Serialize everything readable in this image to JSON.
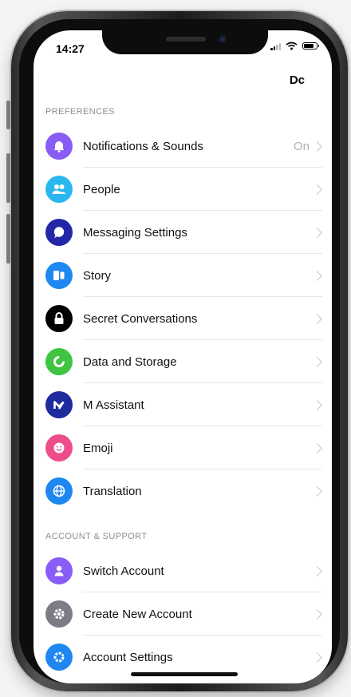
{
  "status_bar": {
    "time": "14:27"
  },
  "header": {
    "action_label": "Dc"
  },
  "sections": [
    {
      "title": "PREFERENCES",
      "items": [
        {
          "label": "Notifications & Sounds",
          "value": "On",
          "icon": "bell-icon",
          "color": "#8a5cf6"
        },
        {
          "label": "People",
          "value": "",
          "icon": "people-icon",
          "color": "#2ab7f0"
        },
        {
          "label": "Messaging Settings",
          "value": "",
          "icon": "chat-bubble-icon",
          "color": "#2426a8"
        },
        {
          "label": "Story",
          "value": "",
          "icon": "story-icon",
          "color": "#1e88f0"
        },
        {
          "label": "Secret Conversations",
          "value": "",
          "icon": "lock-icon",
          "color": "#000000"
        },
        {
          "label": "Data and Storage",
          "value": "",
          "icon": "data-circle-icon",
          "color": "#3ec43e"
        },
        {
          "label": "M Assistant",
          "value": "",
          "icon": "m-assistant-icon",
          "color": "#1f2a9c"
        },
        {
          "label": "Emoji",
          "value": "",
          "icon": "smiley-icon",
          "color": "#ee4d8b"
        },
        {
          "label": "Translation",
          "value": "",
          "icon": "globe-icon",
          "color": "#1e88f0"
        }
      ]
    },
    {
      "title": "ACCOUNT & SUPPORT",
      "items": [
        {
          "label": "Switch Account",
          "value": "",
          "icon": "person-icon",
          "color": "#8a5cf6"
        },
        {
          "label": "Create New Account",
          "value": "",
          "icon": "gear-icon",
          "color": "#7c7c86"
        },
        {
          "label": "Account Settings",
          "value": "",
          "icon": "gear-icon",
          "color": "#1e88f0"
        }
      ]
    }
  ]
}
